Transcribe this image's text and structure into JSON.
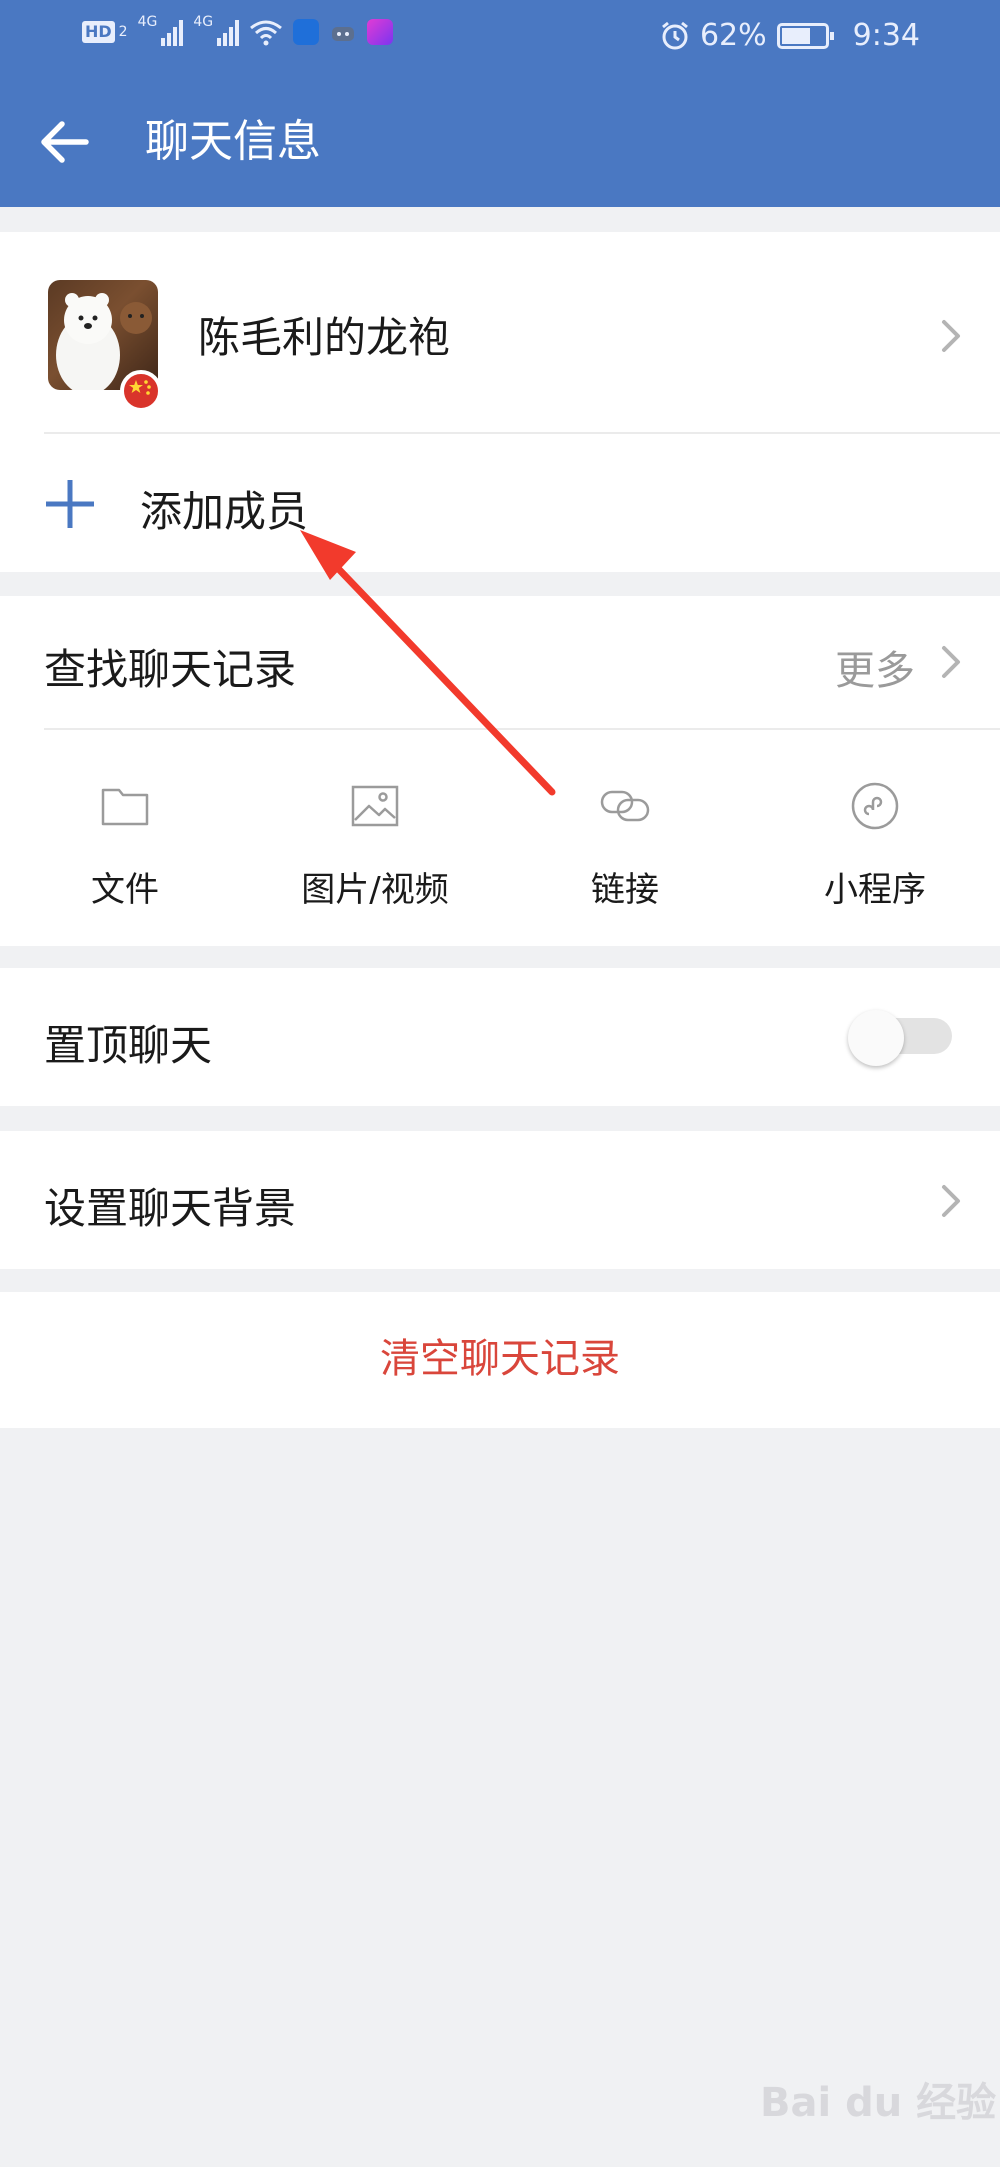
{
  "status": {
    "hd": "HD",
    "hd_sub": "2",
    "net1": "4G",
    "net2": "4G",
    "battery_pct": "62%",
    "time": "9:34"
  },
  "header": {
    "title": "聊天信息"
  },
  "contact": {
    "name": "陈毛利的龙袍"
  },
  "add_member": {
    "label": "添加成员"
  },
  "search": {
    "label": "查找聊天记录",
    "more": "更多"
  },
  "media": [
    {
      "label": "文件",
      "icon": "folder-icon"
    },
    {
      "label": "图片/视频",
      "icon": "image-icon"
    },
    {
      "label": "链接",
      "icon": "link-icon"
    },
    {
      "label": "小程序",
      "icon": "mini-program-icon"
    }
  ],
  "pin_chat": {
    "label": "置顶聊天",
    "enabled": false
  },
  "background": {
    "label": "设置聊天背景"
  },
  "clear": {
    "label": "清空聊天记录"
  },
  "watermark": {
    "text": "Bai du 经验"
  },
  "colors": {
    "header": "#4a78c2",
    "accent": "#4a78c2",
    "danger": "#d9463b",
    "annotation_arrow": "#f23a2c"
  }
}
